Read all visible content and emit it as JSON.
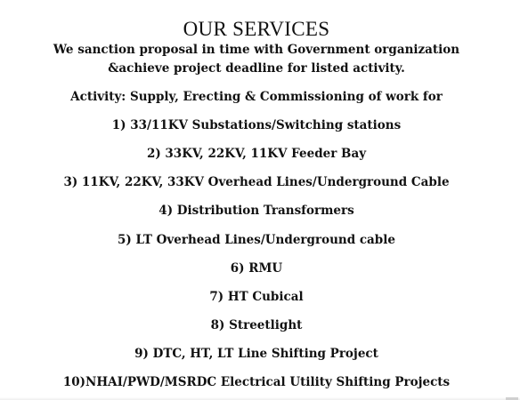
{
  "document": {
    "title": "OUR SERVICES",
    "intro_line_1": "We sanction proposal in time with Government organization",
    "intro_line_2": "&achieve project deadline for listed activity.",
    "activity_heading": "Activity: Supply, Erecting & Commissioning of work for",
    "items": [
      "1) 33/11KV Substations/Switching stations",
      "2) 33KV, 22KV, 11KV Feeder Bay",
      "3) 11KV, 22KV, 33KV Overhead Lines/Underground Cable",
      "4) Distribution Transformers",
      "5) LT Overhead Lines/Underground cable",
      "6) RMU",
      "7) HT Cubical",
      "8) Streetlight",
      "9) DTC, HT, LT Line Shifting Project",
      "10)NHAI/PWD/MSRDC Electrical Utility Shifting Projects"
    ]
  }
}
